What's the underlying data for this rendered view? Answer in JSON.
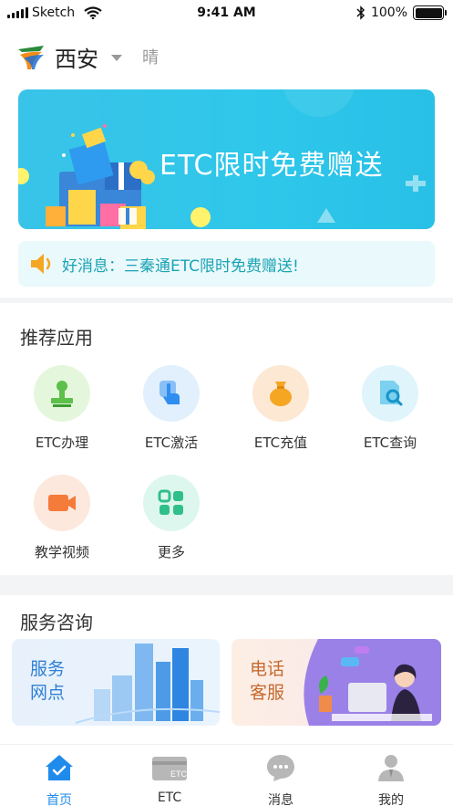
{
  "status_bar": {
    "carrier": "Sketch",
    "time": "9:41 AM",
    "battery": "100%"
  },
  "header": {
    "city": "西安",
    "weather": "晴"
  },
  "banner": {
    "text": "ETC限时免费赠送"
  },
  "notice": {
    "text": "好消息：三秦通ETC限时免费赠送!"
  },
  "recommended": {
    "title": "推荐应用",
    "apps": [
      {
        "label": "ETC办理",
        "icon": "stamp-icon"
      },
      {
        "label": "ETC激活",
        "icon": "touch-icon"
      },
      {
        "label": "ETC充值",
        "icon": "money-bag-icon"
      },
      {
        "label": "ETC查询",
        "icon": "document-search-icon"
      },
      {
        "label": "教学视频",
        "icon": "video-camera-icon"
      },
      {
        "label": "更多",
        "icon": "grid-icon"
      }
    ]
  },
  "service": {
    "title": "服务咨询",
    "cards": [
      {
        "line1": "服务",
        "line2": "网点"
      },
      {
        "line1": "电话",
        "line2": "客服"
      }
    ]
  },
  "tabbar": {
    "tabs": [
      {
        "label": "首页",
        "active": true
      },
      {
        "label": "ETC",
        "active": false
      },
      {
        "label": "消息",
        "active": false
      },
      {
        "label": "我的",
        "active": false
      }
    ],
    "etc_icon_text": "ETC"
  },
  "colors": {
    "accent": "#1f8bea",
    "notice_text": "#1aa3b5",
    "banner": "#2fc7ea"
  }
}
